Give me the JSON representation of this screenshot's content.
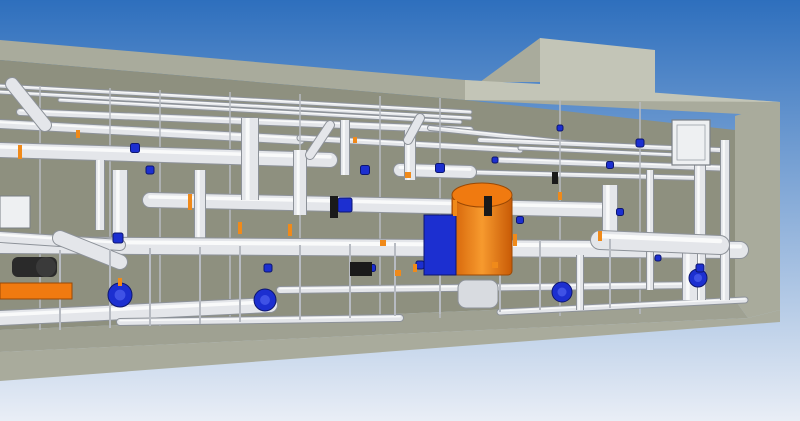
{
  "scene": {
    "kind": "3d-render",
    "subject": "industrial-piping-skid",
    "colors": {
      "sky_top": "#2e6fbd",
      "sky_bottom": "#e9eef6",
      "wall": "#a9ab9c",
      "wall_dark": "#8e907f",
      "wall_light": "#c3c5b7",
      "floor": "#9fa192",
      "pipe": "#e4e6ea",
      "pipe_shadow": "#b7bbc2",
      "pipe_edge": "#8d9299",
      "valve_blue": "#1c2fd0",
      "flange_orange": "#f08a1a",
      "tank_orange": "#f07a10",
      "black": "#1a1a1a"
    },
    "equipment": {
      "main_vessel_count": 1,
      "pump_count": 4,
      "electrical_panel_count": 1
    }
  }
}
